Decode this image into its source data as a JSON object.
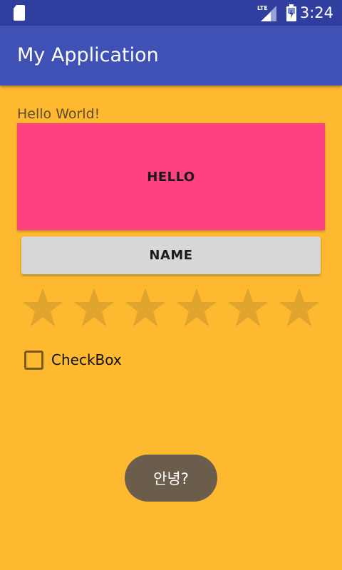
{
  "status_bar": {
    "time": "3:24",
    "network_label": "LTE",
    "bg_color": "#303F9F"
  },
  "app_bar": {
    "title": "My Application",
    "bg_color": "#3F51B5"
  },
  "content": {
    "bg_color": "#FFB930",
    "hello_text": "Hello World!",
    "hello_block_label": "HELLO",
    "hello_block_color": "#FF4081",
    "name_button_label": "NAME",
    "rating": {
      "num_stars": 6,
      "rating": 0
    },
    "checkbox": {
      "label": "CheckBox",
      "checked": false
    }
  },
  "toast": {
    "text": "안녕?"
  },
  "icons": {
    "sd_card": "sd-card-icon",
    "signal": "lte-signal-icon",
    "battery": "battery-icon",
    "star": "star-icon"
  }
}
